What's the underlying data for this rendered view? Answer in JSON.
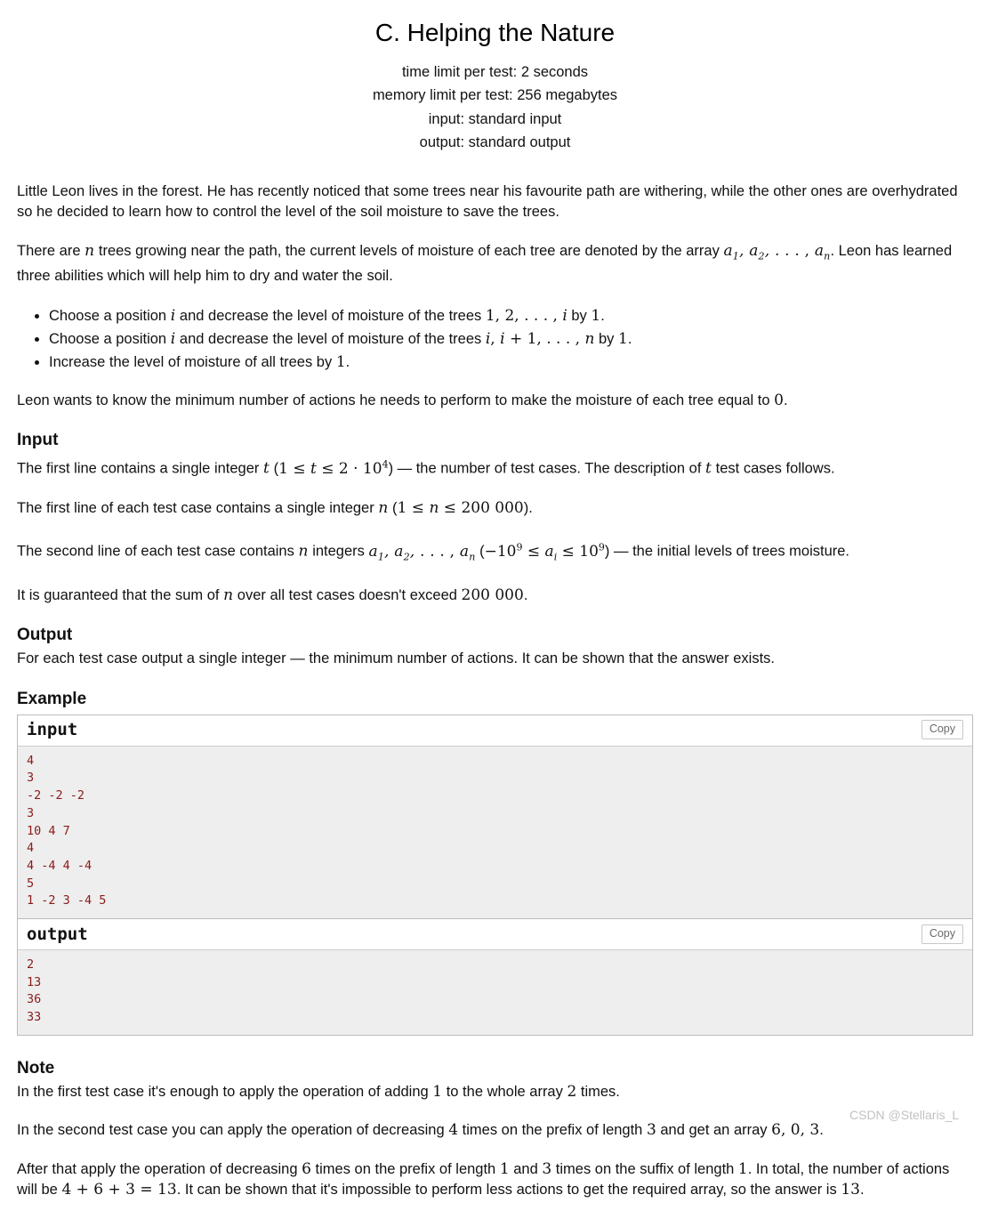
{
  "header": {
    "title": "C. Helping the Nature",
    "time_limit": "time limit per test: 2 seconds",
    "memory_limit": "memory limit per test: 256 megabytes",
    "input_spec": "input: standard input",
    "output_spec": "output: standard output"
  },
  "statement": {
    "p1": "Little Leon lives in the forest. He has recently noticed that some trees near his favourite path are withering, while the other ones are overhydrated so he decided to learn how to control the level of the soil moisture to save the trees.",
    "p2_a": "There are ",
    "p2_n": "n",
    "p2_b": " trees growing near the path, the current levels of moisture of each tree are denoted by the array ",
    "p2_array": "a1, a2, . . . , an",
    "p2_c": ". Leon has learned three abilities which will help him to dry and water the soil.",
    "abilities": [
      {
        "a": "Choose a position ",
        "var": "i",
        "b": " and decrease the level of moisture of the trees ",
        "range": "1, 2, . . . , i",
        "c": " by ",
        "num": "1",
        "d": "."
      },
      {
        "a": "Choose a position ",
        "var": "i",
        "b": " and decrease the level of moisture of the trees ",
        "range": "i, i + 1, . . . , n",
        "c": " by ",
        "num": "1",
        "d": "."
      },
      {
        "a": "Increase the level of moisture of all trees by ",
        "var": "",
        "b": "",
        "range": "",
        "c": "",
        "num": "1",
        "d": "."
      }
    ],
    "p3_a": "Leon wants to know the minimum number of actions he needs to perform to make the moisture of each tree equal to ",
    "p3_num": "0",
    "p3_b": "."
  },
  "input_section": {
    "heading": "Input",
    "l1_a": "The first line contains a single integer ",
    "l1_t": "t",
    "l1_b": " (",
    "l1_constraint": "1 ≤ t ≤ 2 · 10",
    "l1_exp": "4",
    "l1_c": ") — the number of test cases. The description of ",
    "l1_t2": "t",
    "l1_d": " test cases follows.",
    "l2_a": "The first line of each test case contains a single integer ",
    "l2_n": "n",
    "l2_b": " (",
    "l2_constraint": "1 ≤ n ≤ 200 000",
    "l2_c": ").",
    "l3_a": "The second line of each test case contains ",
    "l3_n": "n",
    "l3_b": " integers ",
    "l3_array": "a1, a2, . . . , an",
    "l3_c": " (",
    "l3_lo": "−10",
    "l3_lo_exp": "9",
    "l3_mid": " ≤ a",
    "l3_mid_sub": "i",
    "l3_mid2": " ≤ 10",
    "l3_hi_exp": "9",
    "l3_d": ") — the initial levels of trees moisture.",
    "l4_a": "It is guaranteed that the sum of ",
    "l4_n": "n",
    "l4_b": " over all test cases doesn't exceed ",
    "l4_num": "200 000",
    "l4_c": "."
  },
  "output_section": {
    "heading": "Output",
    "text": "For each test case output a single integer — the minimum number of actions. It can be shown that the answer exists."
  },
  "example_section": {
    "heading": "Example",
    "copy_label": "Copy",
    "blocks": [
      {
        "title": "input",
        "content": "4\n3\n-2 -2 -2\n3\n10 4 7\n4\n4 -4 4 -4\n5\n1 -2 3 -4 5"
      },
      {
        "title": "output",
        "content": "2\n13\n36\n33"
      }
    ]
  },
  "note_section": {
    "heading": "Note",
    "n1_a": "In the first test case it's enough to apply the operation of adding ",
    "n1_num1": "1",
    "n1_b": " to the whole array ",
    "n1_num2": "2",
    "n1_c": " times.",
    "n2_a": "In the second test case you can apply the operation of decreasing ",
    "n2_num1": "4",
    "n2_b": " times on the prefix of length ",
    "n2_num2": "3",
    "n2_c": " and get an array ",
    "n2_array": "6, 0, 3",
    "n2_d": ".",
    "n3_a": "After that apply the operation of decreasing ",
    "n3_num1": "6",
    "n3_b": " times on the prefix of length ",
    "n3_num2": "1",
    "n3_c": " and ",
    "n3_num3": "3",
    "n3_d": " times on the suffix of length ",
    "n3_num4": "1",
    "n3_e": ". In total, the number of actions will be ",
    "n3_eq": "4 + 6 + 3 = 13",
    "n3_f": ". It can be shown that it's impossible to perform less actions to get the required array, so the answer is ",
    "n3_num5": "13",
    "n3_g": "."
  },
  "watermark": {
    "text": "CSDN @Stellaris_L"
  }
}
